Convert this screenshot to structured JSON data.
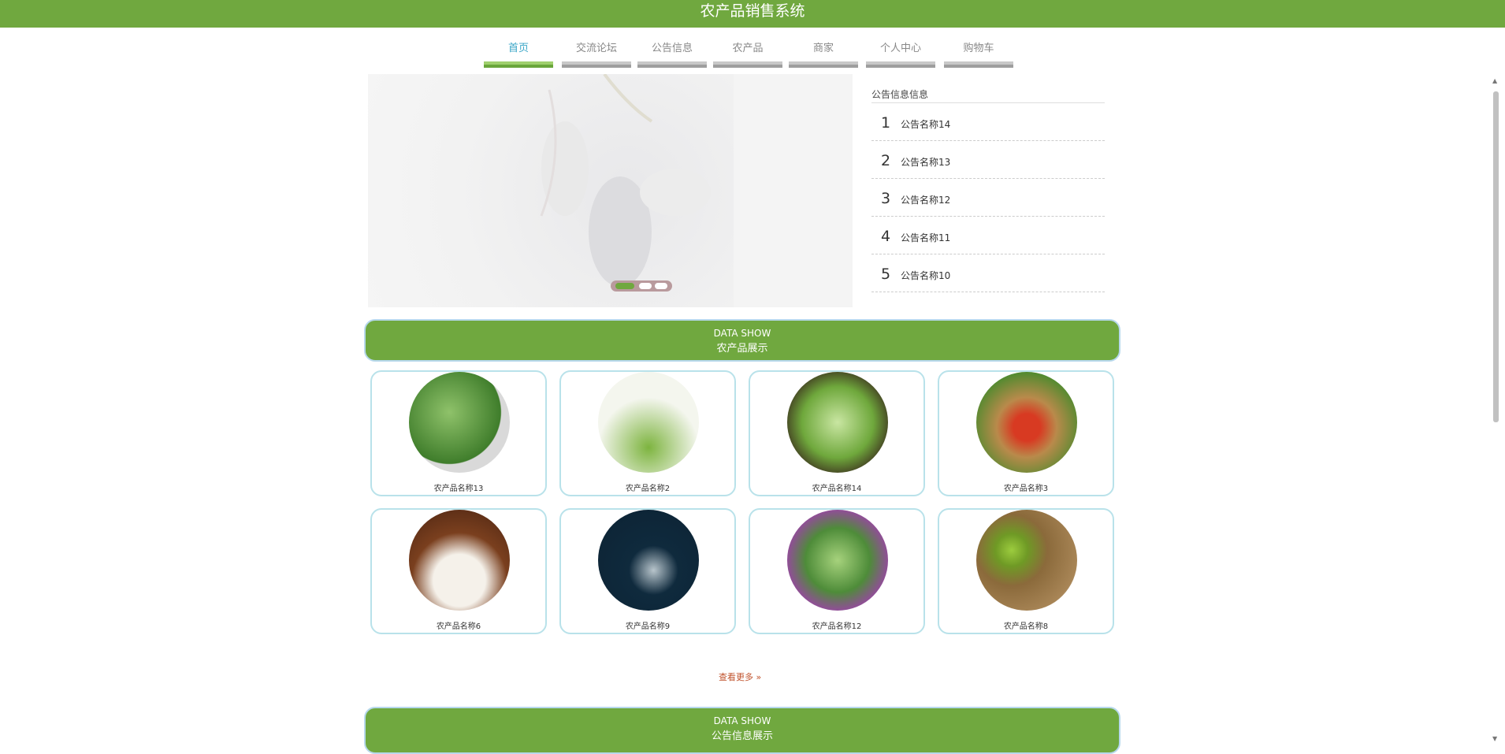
{
  "header": {
    "title": "农产品销售系统"
  },
  "nav": {
    "items": [
      {
        "label": "首页",
        "active": true
      },
      {
        "label": "交流论坛"
      },
      {
        "label": "公告信息"
      },
      {
        "label": "农产品"
      },
      {
        "label": "商家"
      },
      {
        "label": "个人中心"
      },
      {
        "label": "购物车"
      }
    ]
  },
  "notice": {
    "title": "公告信息信息",
    "items": [
      {
        "num": "1",
        "title": "公告名称14"
      },
      {
        "num": "2",
        "title": "公告名称13"
      },
      {
        "num": "3",
        "title": "公告名称12"
      },
      {
        "num": "4",
        "title": "公告名称11"
      },
      {
        "num": "5",
        "title": "公告名称10"
      }
    ]
  },
  "products_section": {
    "en": "DATA SHOW",
    "cn": "农产品展示"
  },
  "products": [
    {
      "name": "农产品名称13",
      "image": "cabbage-photo"
    },
    {
      "name": "农产品名称2",
      "image": "fresh-vegetables-poster"
    },
    {
      "name": "农产品名称14",
      "image": "chinese-cabbage-photo"
    },
    {
      "name": "农产品名称3",
      "image": "vegetable-basket-photo"
    },
    {
      "name": "农产品名称6",
      "image": "rice-bowl-photo"
    },
    {
      "name": "农产品名称9",
      "image": "rice-poster"
    },
    {
      "name": "农产品名称12",
      "image": "mixed-vegetables-photo"
    },
    {
      "name": "农产品名称8",
      "image": "kiwi-fruit-photo"
    }
  ],
  "more_label": "查看更多 »",
  "notice_section": {
    "en": "DATA SHOW",
    "cn": "公告信息展示"
  },
  "colors": {
    "brand": "#70a83f",
    "active_nav": "#3aa6c7",
    "more": "#c0522c"
  }
}
